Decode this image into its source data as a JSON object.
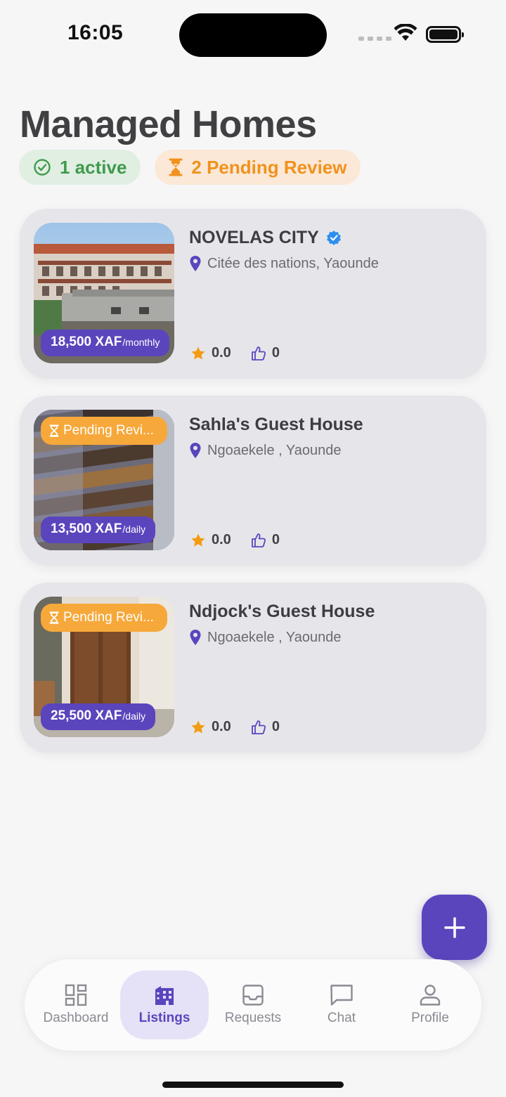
{
  "status_bar": {
    "time": "16:05"
  },
  "header": {
    "title": "Managed Homes",
    "active_chip": "1 active",
    "pending_chip": "2 Pending Review"
  },
  "listings": [
    {
      "name": "NOVELAS CITY",
      "verified": true,
      "location": "Citée des nations, Yaounde",
      "price": "18,500 XAF",
      "unit": "/monthly",
      "status": "",
      "rating": "0.0",
      "likes": "0"
    },
    {
      "name": "Sahla's Guest House",
      "verified": false,
      "location": "Ngoaekele , Yaounde",
      "price": "13,500 XAF",
      "unit": "/daily",
      "status": "Pending Revi...",
      "rating": "0.0",
      "likes": "0"
    },
    {
      "name": "Ndjock's Guest House",
      "verified": false,
      "location": "Ngoaekele , Yaounde",
      "price": "25,500 XAF",
      "unit": "/daily",
      "status": "Pending Revi...",
      "rating": "0.0",
      "likes": "0"
    }
  ],
  "nav": {
    "items": [
      {
        "label": "Dashboard",
        "icon": "dashboard-icon"
      },
      {
        "label": "Listings",
        "icon": "building-icon"
      },
      {
        "label": "Requests",
        "icon": "inbox-icon"
      },
      {
        "label": "Chat",
        "icon": "chat-icon"
      },
      {
        "label": "Profile",
        "icon": "person-icon"
      }
    ],
    "active": "Listings"
  },
  "colors": {
    "accent": "#5b45bd",
    "active_green": "#3f9a4d",
    "pending_orange": "#f0921e",
    "badge_orange": "#f6a83a",
    "star": "#f39c12",
    "verified_blue": "#2d8ef0"
  }
}
